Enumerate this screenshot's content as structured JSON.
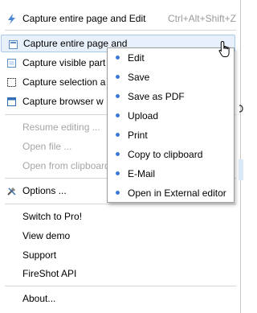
{
  "menu": {
    "items": [
      {
        "label": "Capture entire page and Edit",
        "accel": "Ctrl+Alt+Shift+Z",
        "icon": "lightning-icon",
        "state": "normal"
      },
      {
        "label": "Capture entire page and",
        "icon": "page-icon",
        "state": "hover"
      },
      {
        "label": "Capture visible part",
        "icon": "visible-area-icon",
        "state": "normal"
      },
      {
        "label": "Capture selection a",
        "icon": "selection-icon",
        "state": "normal"
      },
      {
        "label": "Capture browser w",
        "icon": "browser-window-icon",
        "state": "normal"
      },
      {
        "label": "Resume editing ...",
        "state": "disabled"
      },
      {
        "label": "Open file ...",
        "state": "disabled"
      },
      {
        "label": "Open from clipboard",
        "state": "disabled"
      },
      {
        "label": "Options ...",
        "icon": "tools-icon",
        "state": "normal"
      },
      {
        "label": "Switch to Pro!",
        "state": "normal"
      },
      {
        "label": "View demo",
        "state": "normal"
      },
      {
        "label": "Support",
        "state": "normal"
      },
      {
        "label": "FireShot API",
        "state": "normal"
      },
      {
        "label": "About...",
        "state": "normal"
      }
    ]
  },
  "submenu": {
    "items": [
      "Edit",
      "Save",
      "Save as PDF",
      "Upload",
      "Print",
      "Copy to clipboard",
      "E-Mail",
      "Open in External editor"
    ]
  },
  "colors": {
    "hover_bg": "#e8f1fb",
    "hover_border": "#a9c9ef",
    "bullet": "#3d7bd3",
    "disabled_text": "#a6a6a6"
  },
  "cursor": "hand-pointer-icon"
}
